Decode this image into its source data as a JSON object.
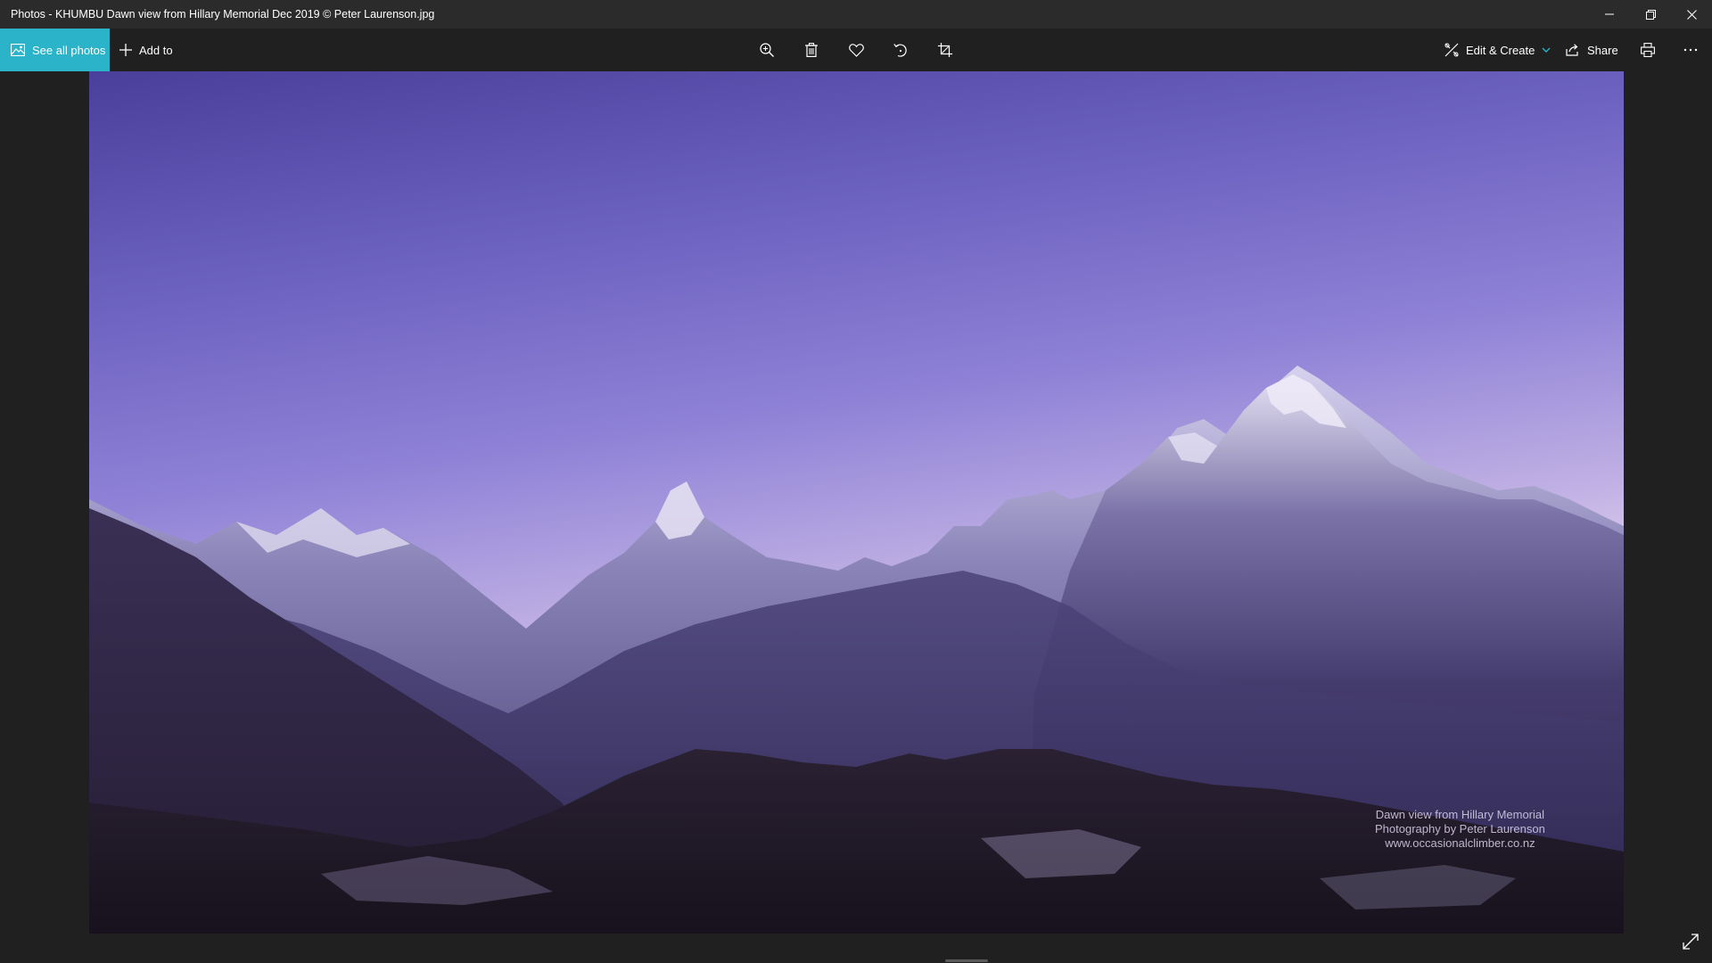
{
  "window": {
    "title": "Photos - KHUMBU Dawn view from Hillary Memorial Dec 2019 © Peter Laurenson.jpg",
    "controls": [
      "minimize-icon",
      "restore-icon",
      "close-icon"
    ]
  },
  "toolbar": {
    "see_all_label": "See all photos",
    "add_to_label": "Add to",
    "center_actions": [
      "zoom-in-icon",
      "delete-icon",
      "favorite-heart-icon",
      "rotate-icon",
      "crop-icon"
    ],
    "edit_create_label": "Edit & Create",
    "share_label": "Share",
    "print_icon": "print-icon",
    "more_icon": "more-ellipsis-icon",
    "accent_color": "#2ab3c9"
  },
  "photo": {
    "watermark": {
      "line1": "Dawn view from Hillary Memorial",
      "line2": "Photography by Peter Laurenson",
      "line3": "www.occasionalclimber.co.nz"
    }
  },
  "footer": {
    "expand_icon": "expand-fullscreen-icon"
  }
}
